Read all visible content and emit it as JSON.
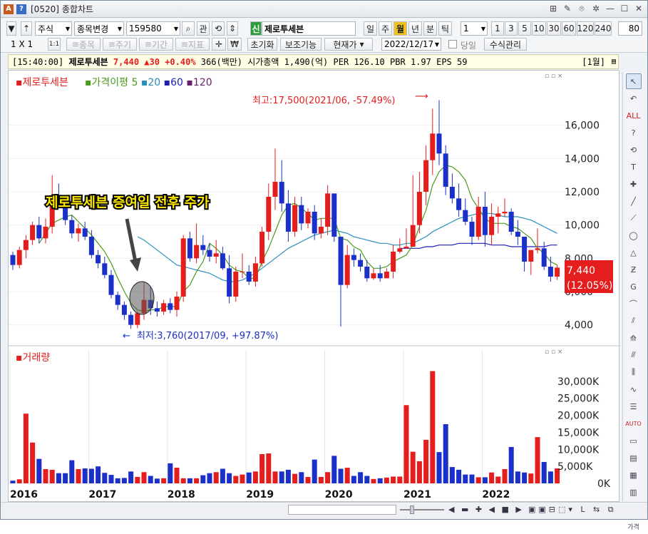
{
  "window": {
    "code": "[0520]",
    "title": "종합차트"
  },
  "toolbar": {
    "market": "주식",
    "change_label": "종목변경",
    "code_value": "159580",
    "kwan": "관",
    "shin": "신",
    "stock_name": "제로투세븐",
    "periods": [
      "일",
      "주",
      "월",
      "년",
      "분",
      "틱"
    ],
    "active_period": "월",
    "interval_value": "1",
    "intervals": [
      "1",
      "3",
      "5",
      "10",
      "30",
      "60",
      "120",
      "240"
    ],
    "count_value": "80"
  },
  "toolbar2": {
    "layout": "1 X 1",
    "btn_1": "1:1",
    "dis": [
      "종목",
      "주기",
      "기간",
      "지표"
    ],
    "reset": "초기화",
    "assist": "보조기능",
    "price_mode": "현재가",
    "date": "2022/12/17",
    "today": "당일",
    "formula": "수식관리"
  },
  "infobar": {
    "time": "[15:40:00]",
    "name": "제로투세븐",
    "price": "7,440",
    "change": "▲30",
    "pct": "+0.40%",
    "volume": "366(백만)",
    "cap_label": "시가총액",
    "cap": "1,490(억)",
    "per_label": "PER",
    "per": "126.10",
    "pbr_label": "PBR",
    "pbr": "1.97",
    "eps_label": "EPS",
    "eps": "59",
    "period": "[1월]"
  },
  "legend": {
    "name": "제로투세븐",
    "ma_label": "가격이평",
    "ma": [
      "5",
      "20",
      "60",
      "120"
    ]
  },
  "annotations": {
    "high": "최고:17,500(2021/06, -57.49%)",
    "low": "최저:3,760(2017/09, +97.87%)",
    "headline": "제로투세븐 증여일 전후 주가",
    "price_tag": "7,440",
    "pct_tag": "(12.05%)"
  },
  "volume_panel": {
    "label": "거래량"
  },
  "colors": {
    "up": "#e41d1d",
    "down": "#1b30c8",
    "ma5": "#4a9a1c",
    "ma20": "#2a8fbe",
    "ma60": "#1d1db8",
    "ma120": "#6a1f6a"
  },
  "chart_data": {
    "type": "candlestick",
    "x": [
      "2016-01",
      "2016-02",
      "2016-03",
      "2016-04",
      "2016-05",
      "2016-06",
      "2016-07",
      "2016-08",
      "2016-09",
      "2016-10",
      "2016-11",
      "2016-12",
      "2017-01",
      "2017-02",
      "2017-03",
      "2017-04",
      "2017-05",
      "2017-06",
      "2017-07",
      "2017-08",
      "2017-09",
      "2017-10",
      "2017-11",
      "2017-12",
      "2018-01",
      "2018-02",
      "2018-03",
      "2018-04",
      "2018-05",
      "2018-06",
      "2018-07",
      "2018-08",
      "2018-09",
      "2018-10",
      "2018-11",
      "2018-12",
      "2019-01",
      "2019-02",
      "2019-03",
      "2019-04",
      "2019-05",
      "2019-06",
      "2019-07",
      "2019-08",
      "2019-09",
      "2019-10",
      "2019-11",
      "2019-12",
      "2020-01",
      "2020-02",
      "2020-03",
      "2020-04",
      "2020-05",
      "2020-06",
      "2020-07",
      "2020-08",
      "2020-09",
      "2020-10",
      "2020-11",
      "2020-12",
      "2021-01",
      "2021-02",
      "2021-03",
      "2021-04",
      "2021-05",
      "2021-06",
      "2021-07",
      "2021-08",
      "2021-09",
      "2021-10",
      "2021-11",
      "2021-12",
      "2022-01",
      "2022-02",
      "2022-03",
      "2022-04",
      "2022-05",
      "2022-06",
      "2022-07",
      "2022-08",
      "2022-09",
      "2022-10",
      "2022-11",
      "2022-12"
    ],
    "candles": [
      [
        8200,
        8400,
        7300,
        7600
      ],
      [
        7600,
        8700,
        7400,
        8500
      ],
      [
        8500,
        9400,
        8000,
        9100
      ],
      [
        9100,
        10200,
        8800,
        10000
      ],
      [
        10000,
        10500,
        8900,
        9200
      ],
      [
        9200,
        10400,
        8900,
        9900
      ],
      [
        9900,
        13000,
        9500,
        11800
      ],
      [
        11800,
        12500,
        11000,
        11300
      ],
      [
        11300,
        11600,
        10000,
        10300
      ],
      [
        10300,
        10600,
        9200,
        9500
      ],
      [
        9500,
        10100,
        9000,
        9800
      ],
      [
        9800,
        10200,
        9100,
        9300
      ],
      [
        9300,
        9700,
        8000,
        8200
      ],
      [
        8200,
        8500,
        7400,
        7700
      ],
      [
        7700,
        8100,
        6800,
        7000
      ],
      [
        7000,
        7300,
        5600,
        5800
      ],
      [
        5800,
        6000,
        4900,
        5200
      ],
      [
        5200,
        5400,
        4300,
        4600
      ],
      [
        4600,
        4800,
        3760,
        4000
      ],
      [
        4000,
        4800,
        3800,
        4700
      ],
      [
        4700,
        6600,
        4300,
        5500
      ],
      [
        5500,
        6300,
        4600,
        5000
      ],
      [
        5000,
        5400,
        4500,
        4800
      ],
      [
        4800,
        5500,
        4600,
        5300
      ],
      [
        5300,
        5600,
        4700,
        4900
      ],
      [
        4900,
        6000,
        4500,
        5700
      ],
      [
        5700,
        9400,
        5400,
        9200
      ],
      [
        9200,
        9600,
        7800,
        8000
      ],
      [
        8000,
        10100,
        7700,
        8800
      ],
      [
        8800,
        9400,
        8200,
        8500
      ],
      [
        8500,
        8900,
        7800,
        8100
      ],
      [
        8100,
        9100,
        7700,
        8300
      ],
      [
        8300,
        8700,
        7300,
        7400
      ],
      [
        7400,
        8200,
        5300,
        5700
      ],
      [
        5700,
        7500,
        5400,
        7200
      ],
      [
        7200,
        8300,
        6800,
        7200
      ],
      [
        7200,
        7600,
        6400,
        6600
      ],
      [
        6600,
        8100,
        6300,
        7700
      ],
      [
        7700,
        9900,
        7500,
        9600
      ],
      [
        9600,
        12500,
        9100,
        11700
      ],
      [
        11700,
        14600,
        10900,
        12600
      ],
      [
        12600,
        13900,
        10800,
        11300
      ],
      [
        11300,
        12100,
        9000,
        9600
      ],
      [
        9600,
        11700,
        9300,
        11200
      ],
      [
        11200,
        11700,
        9700,
        10100
      ],
      [
        10100,
        11000,
        9800,
        10800
      ],
      [
        10800,
        11200,
        9100,
        9500
      ],
      [
        9500,
        10400,
        9200,
        9900
      ],
      [
        9900,
        12400,
        9400,
        11900
      ],
      [
        11900,
        11500,
        9000,
        9300
      ],
      [
        9300,
        9300,
        3900,
        6400
      ],
      [
        6400,
        8800,
        6200,
        8200
      ],
      [
        8200,
        8600,
        7500,
        7900
      ],
      [
        7900,
        8300,
        7200,
        7500
      ],
      [
        7500,
        7900,
        6600,
        6800
      ],
      [
        6800,
        7400,
        6700,
        7100
      ],
      [
        7100,
        7600,
        6600,
        6800
      ],
      [
        6800,
        7400,
        6800,
        7200
      ],
      [
        7200,
        8800,
        6800,
        8400
      ],
      [
        8400,
        9200,
        8300,
        8600
      ],
      [
        8600,
        9800,
        8700,
        8700
      ],
      [
        8700,
        13000,
        8700,
        10000
      ],
      [
        10000,
        13200,
        9500,
        12000
      ],
      [
        12000,
        14800,
        11200,
        13900
      ],
      [
        13900,
        17000,
        13000,
        15500
      ],
      [
        15500,
        17500,
        13600,
        14300
      ],
      [
        14300,
        14800,
        11800,
        12300
      ],
      [
        12300,
        13100,
        11300,
        11600
      ],
      [
        11600,
        12500,
        10500,
        10900
      ],
      [
        10900,
        11600,
        10000,
        10200
      ],
      [
        10200,
        10500,
        8800,
        9300
      ],
      [
        9300,
        11700,
        9100,
        11100
      ],
      [
        11100,
        12000,
        8700,
        9400
      ],
      [
        9400,
        11300,
        8800,
        10500
      ],
      [
        10500,
        11100,
        9500,
        10700
      ],
      [
        10700,
        11600,
        10500,
        10800
      ],
      [
        10800,
        11000,
        9400,
        9600
      ],
      [
        9600,
        10300,
        8800,
        9300
      ],
      [
        9300,
        9300,
        7200,
        7800
      ],
      [
        7800,
        8500,
        7000,
        8500
      ],
      [
        8500,
        9800,
        8300,
        8600
      ],
      [
        8600,
        9000,
        7300,
        7500
      ],
      [
        7500,
        8100,
        6600,
        6900
      ],
      [
        6900,
        7600,
        6700,
        7440
      ]
    ],
    "volume_k": [
      800,
      1200,
      20500,
      12000,
      7200,
      4200,
      4000,
      3000,
      3000,
      6800,
      4200,
      4400,
      4300,
      5000,
      3100,
      2500,
      1500,
      1600,
      3500,
      1900,
      3300,
      2200,
      1400,
      1500,
      5900,
      4600,
      1500,
      1500,
      1500,
      2400,
      3000,
      3300,
      4300,
      3000,
      2200,
      2600,
      3200,
      3500,
      8600,
      8800,
      3500,
      3500,
      4000,
      2800,
      3300,
      1900,
      7000,
      1900,
      3300,
      8100,
      4300,
      4600,
      2200,
      3300,
      2200,
      1300,
      1500,
      1700,
      2000,
      2000,
      23000,
      9300,
      6500,
      12800,
      33000,
      9200,
      17400,
      4800,
      4000,
      2600,
      2600,
      1800,
      1800,
      3200,
      2000,
      4200,
      10700,
      3500,
      3200,
      2900,
      13600,
      6300,
      3500,
      4400
    ],
    "ma5": [
      null,
      null,
      null,
      null,
      8900,
      9500,
      10100,
      10300,
      10500,
      10600,
      10200,
      9800,
      9400,
      8900,
      8400,
      7700,
      6800,
      6000,
      5300,
      4900,
      4800,
      4900,
      4900,
      5100,
      5100,
      5100,
      6000,
      6400,
      7200,
      7800,
      8900,
      8600,
      8200,
      7600,
      7300,
      7200,
      6800,
      6800,
      7800,
      8600,
      9600,
      10600,
      11200,
      11300,
      11000,
      10700,
      10300,
      10400,
      10400,
      10400,
      9200,
      9100,
      8700,
      8500,
      7800,
      7400,
      7400,
      7500,
      7800,
      8000,
      8200,
      8800,
      9900,
      10900,
      12400,
      13200,
      13600,
      13500,
      13200,
      12700,
      11600,
      11000,
      10400,
      10100,
      10100,
      10100,
      9900,
      9800,
      9500,
      9200,
      8600,
      8300,
      7800,
      7600
    ],
    "ma20": [
      null,
      null,
      null,
      null,
      null,
      null,
      null,
      null,
      null,
      null,
      null,
      null,
      null,
      null,
      null,
      null,
      null,
      null,
      null,
      9300,
      9100,
      8800,
      8500,
      8200,
      7900,
      7600,
      7500,
      7400,
      7300,
      7200,
      7100,
      6900,
      6700,
      6600,
      6600,
      6700,
      6900,
      7100,
      7400,
      7700,
      8000,
      8300,
      8600,
      8800,
      9000,
      9200,
      9400,
      9500,
      9600,
      9700,
      9600,
      9500,
      9300,
      9200,
      9100,
      9000,
      8900,
      8900,
      8800,
      8800,
      8900,
      8900,
      9100,
      9300,
      9600,
      9800,
      10000,
      10200,
      10400,
      10500,
      10600,
      10700,
      10700,
      10700,
      10600,
      10500,
      10500,
      10500,
      10400,
      10300,
      10100,
      9900,
      9700,
      9500
    ],
    "ma60": [
      null,
      null,
      null,
      null,
      null,
      null,
      null,
      null,
      null,
      null,
      null,
      null,
      null,
      null,
      null,
      null,
      null,
      null,
      null,
      null,
      null,
      null,
      null,
      null,
      null,
      null,
      null,
      null,
      null,
      null,
      null,
      null,
      null,
      null,
      null,
      null,
      null,
      null,
      null,
      null,
      null,
      null,
      null,
      null,
      null,
      null,
      null,
      null,
      null,
      null,
      null,
      null,
      null,
      null,
      null,
      null,
      null,
      null,
      null,
      8600,
      8600,
      8600,
      8600,
      8700,
      8700,
      8800,
      8800,
      8800,
      8900,
      8900,
      8900,
      8900,
      8900,
      8800,
      8800,
      8800,
      8700,
      8700,
      8700,
      8700,
      8700,
      8700,
      8800,
      8800
    ],
    "ma120": [
      null,
      null,
      null,
      null,
      null,
      null,
      null,
      null,
      null,
      null,
      null,
      null,
      null,
      null,
      null,
      null,
      null,
      null,
      null,
      null,
      null,
      null,
      null,
      null,
      null,
      null,
      null,
      null,
      null,
      null,
      null,
      null,
      null,
      null,
      null,
      null,
      null,
      null,
      null,
      null,
      null,
      null,
      null,
      null,
      null,
      null,
      null,
      null,
      null,
      null,
      null,
      null,
      null,
      null,
      null,
      null,
      null,
      null,
      null,
      null,
      null,
      null,
      null,
      null,
      null,
      null,
      null,
      null,
      null,
      null,
      null,
      null,
      null,
      null,
      null,
      null,
      null,
      null,
      null,
      null,
      null,
      null,
      null,
      null
    ],
    "price_ticks": [
      4000,
      6000,
      8000,
      10000,
      12000,
      14000,
      16000
    ],
    "price_tick_labels": [
      "4,000",
      "6,000",
      "8,000",
      "10,000",
      "12,000",
      "14,000",
      "16,000"
    ],
    "volume_ticks": [
      0,
      5000,
      10000,
      15000,
      20000,
      25000,
      30000
    ],
    "volume_tick_labels": [
      "0K",
      "5,000K",
      "10,000K",
      "15,000K",
      "20,000K",
      "25,000K",
      "30,000K"
    ],
    "year_labels": [
      "2016",
      "2017",
      "2018",
      "2019",
      "2020",
      "2021",
      "2022"
    ],
    "ylim": [
      3000,
      18000
    ],
    "volume_ylim": [
      0,
      35000
    ]
  }
}
